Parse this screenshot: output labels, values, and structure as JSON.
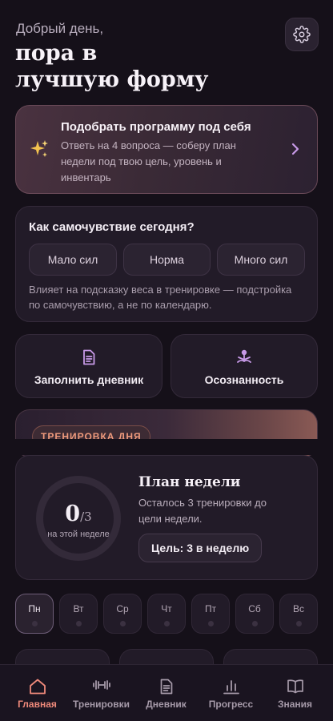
{
  "header": {
    "greeting": "Добрый день,",
    "headline_line1": "пора в",
    "headline_line2": "лучшую форму",
    "settings_icon": "gear-icon"
  },
  "program_card": {
    "icon": "sparkles-icon",
    "title": "Подобрать программу под себя",
    "description_line1": "Ответь на 4 вопроса — соберу план",
    "description_line2": "недели под твою цель, уровень и",
    "description_line3": "инвентарь"
  },
  "mood": {
    "title": "Как самочувствие сегодня?",
    "options": [
      "Мало сил",
      "Норма",
      "Много сил"
    ],
    "note_line1": "Влияет на подсказку веса в тренировке — подстройка",
    "note_line2": "по самочувствию, а не по календарю."
  },
  "actions": {
    "diary_label": "Заполнить дневник",
    "diary_icon": "document-icon",
    "mindfulness_label": "Осознанность",
    "mindfulness_icon": "meditation-icon"
  },
  "workout": {
    "tag": "ТРЕНИРОВКА ДНЯ"
  },
  "week_plan": {
    "done": "0",
    "total": "/3",
    "ring_caption": "на этой неделе",
    "progress_fraction": 0,
    "title": "План недели",
    "subtitle_line1": "Осталось 3 тренировки до",
    "subtitle_line2": "цели недели.",
    "goal_button": "Цель: 3 в неделю"
  },
  "days": [
    "Пн",
    "Вт",
    "Ср",
    "Чт",
    "Пт",
    "Сб",
    "Вс"
  ],
  "active_day": "Пн",
  "nav": {
    "items": [
      {
        "label": "Главная",
        "icon": "home-icon",
        "active": true
      },
      {
        "label": "Тренировки",
        "icon": "dumbbell-icon",
        "active": false
      },
      {
        "label": "Дневник",
        "icon": "document-icon",
        "active": false
      },
      {
        "label": "Прогресс",
        "icon": "bar-chart-icon",
        "active": false
      },
      {
        "label": "Знания",
        "icon": "book-icon",
        "active": false
      }
    ]
  },
  "colors": {
    "background": "#151019",
    "accent": "#f08a7b",
    "icon_purple": "#c89ae8"
  }
}
